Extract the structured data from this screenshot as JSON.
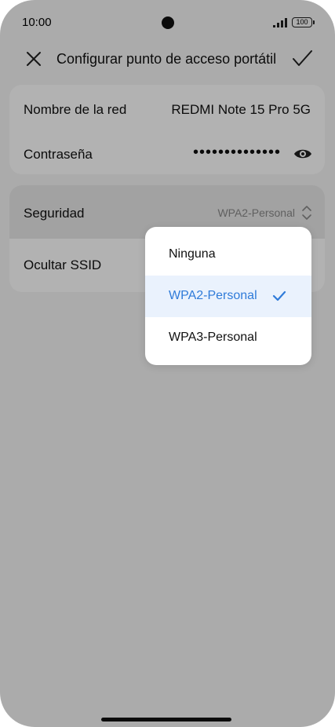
{
  "status_bar": {
    "time": "10:00",
    "battery": "100",
    "icons": [
      "camera-icon",
      "signal-icon",
      "battery-icon"
    ]
  },
  "header": {
    "title": "Configurar punto de acceso portátil",
    "close_icon": "close-icon",
    "confirm_icon": "checkmark-icon"
  },
  "network": {
    "name_label": "Nombre de la red",
    "name_value": "REDMI Note 15 Pro 5G",
    "password_label": "Contraseña",
    "password_masked": "••••••••••••••",
    "password_icon": "eye-icon"
  },
  "security": {
    "label": "Seguridad",
    "value": "WPA2-Personal",
    "selector_icon": "chevron-updown-icon",
    "hide_ssid_label": "Ocultar SSID"
  },
  "dropdown": {
    "options": [
      {
        "label": "Ninguna",
        "selected": false
      },
      {
        "label": "WPA2-Personal",
        "selected": true
      },
      {
        "label": "WPA3-Personal",
        "selected": false
      }
    ],
    "check_icon": "check-icon"
  },
  "colors": {
    "accent": "#2f7bd9",
    "selected_bg": "#eaf2fd",
    "background": "#f5f5f5",
    "dim_overlay": "rgba(0,0,0,0.3)"
  }
}
